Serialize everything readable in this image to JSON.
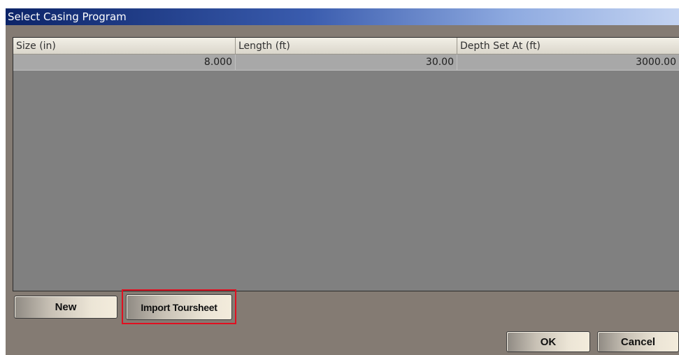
{
  "window": {
    "title": "Select Casing Program"
  },
  "grid": {
    "columns": [
      "Size (in)",
      "Length (ft)",
      "Depth Set At (ft)"
    ],
    "rows": [
      [
        "8.000",
        "30.00",
        "3000.00"
      ]
    ]
  },
  "buttons": {
    "new_label": "New",
    "import_label": "Import Toursheet",
    "ok_label": "OK",
    "cancel_label": "Cancel"
  },
  "colors": {
    "dialog_bg": "#847b73",
    "grid_bg": "#808080",
    "highlight": "#e01020",
    "title_start": "#0c2468",
    "title_end": "#c3d3f1"
  }
}
